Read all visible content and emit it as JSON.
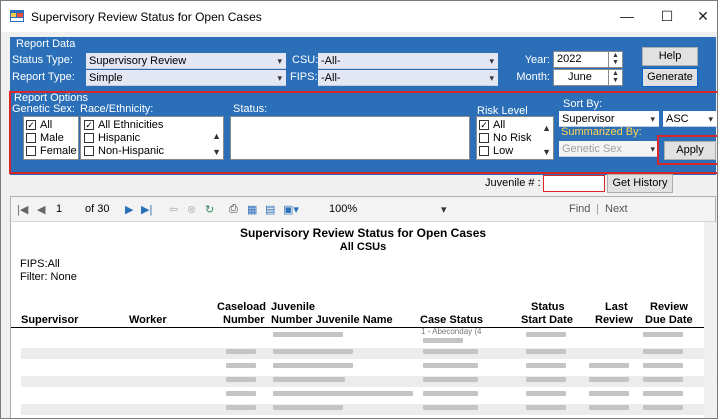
{
  "window": {
    "title": "Supervisory Review Status for Open Cases",
    "controls": [
      "—",
      "☐",
      "✕"
    ]
  },
  "report_data": {
    "group_label": "Report Data",
    "status_type_label": "Status Type:",
    "status_type_value": "Supervisory Review",
    "report_type_label": "Report Type:",
    "report_type_value": "Simple",
    "csu_label": "CSU:",
    "csu_value": "-All-",
    "fips_label": "FIPS:",
    "fips_value": "-All-",
    "year_label": "Year:",
    "year_value": "2022",
    "month_label": "Month:",
    "month_value": "June",
    "help_button": "Help",
    "generate_button": "Generate"
  },
  "report_options": {
    "group_label": "Report Options",
    "genetic_sex_label": "Genetic Sex:",
    "genetic_sex_items": [
      {
        "label": "All",
        "checked": true
      },
      {
        "label": "Male",
        "checked": false
      },
      {
        "label": "Female",
        "checked": false
      }
    ],
    "race_label": "Race/Ethnicity:",
    "race_items": [
      {
        "label": "All Ethnicities",
        "checked": true
      },
      {
        "label": "Hispanic",
        "checked": false
      },
      {
        "label": "Non-Hispanic",
        "checked": false
      }
    ],
    "status_label": "Status:",
    "risk_label": "Risk Level",
    "risk_items": [
      {
        "label": "All",
        "checked": true
      },
      {
        "label": "No Risk",
        "checked": false
      },
      {
        "label": "Low",
        "checked": false
      }
    ],
    "sort_by_label": "Sort By:",
    "sort_by_value": "Supervisor",
    "sort_order_value": "ASC",
    "summarized_by_label": "Summarized By:",
    "summarized_by_value": "Genetic Sex",
    "apply_button": "Apply"
  },
  "juvenile": {
    "label": "Juvenile # :",
    "value": "",
    "get_history_button": "Get History"
  },
  "viewer_toolbar": {
    "page_current": "1",
    "page_total": "of 30",
    "zoom": "100%",
    "find_label": "Find",
    "separator": "|",
    "next_label": "Next"
  },
  "report": {
    "title": "Supervisory Review Status for Open Cases",
    "subtitle": "All CSUs",
    "fips_line": "FIPS:All",
    "filter_line": "Filter: None",
    "columns": {
      "supervisor": "Supervisor",
      "worker": "Worker",
      "caseload_1": "Caseload",
      "caseload_2": "Number",
      "juvenile_1": "Juvenile",
      "juvenile_2": "Number Juvenile Name",
      "case_status": "Case Status",
      "status_start_1": "Status",
      "status_start_2": "Start Date",
      "last_review_1": "Last",
      "last_review_2": "Review",
      "review_due_1": "Review",
      "review_due_2": "Due Date"
    },
    "first_row_partial": "1 - Abeconday (4"
  },
  "colors": {
    "panel_blue": "#2a6fb8",
    "highlight_red": "#d9262b",
    "label_yellow": "#ffd54f"
  }
}
